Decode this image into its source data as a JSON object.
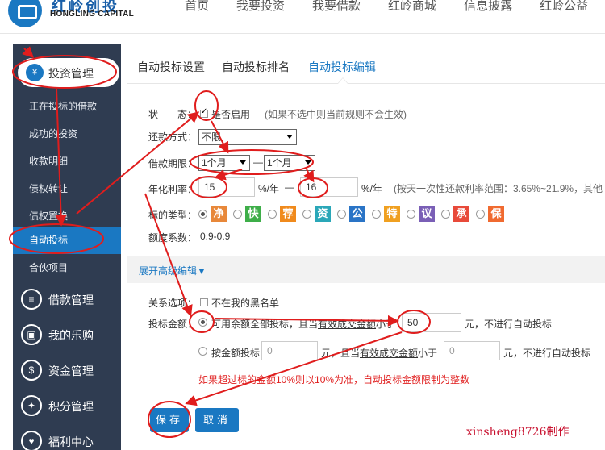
{
  "logo": {
    "cn": "红岭创投",
    "en": "HONGLING CAPITAL"
  },
  "nav": [
    "首页",
    "我要投资",
    "我要借款",
    "红岭商城",
    "信息披露",
    "红岭公益"
  ],
  "sidebar": {
    "header": "投资管理",
    "sub_items": [
      "正在投标的借款",
      "成功的投资",
      "收款明细",
      "债权转让",
      "债权置换",
      "自动投标",
      "合伙项目"
    ],
    "groups": [
      {
        "label": "借款管理",
        "icon": "wallet-icon"
      },
      {
        "label": "我的乐购",
        "icon": "shop-icon"
      },
      {
        "label": "资金管理",
        "icon": "money-bag-icon"
      },
      {
        "label": "积分管理",
        "icon": "gift-icon"
      },
      {
        "label": "福利中心",
        "icon": "heart-icon"
      }
    ]
  },
  "tabs": [
    "自动投标设置",
    "自动投标排名",
    "自动投标编辑"
  ],
  "form": {
    "status_label": "状　　态：",
    "enable_label": "是否启用",
    "enable_hint": "(如果不选中则当前规则不会生效)",
    "repay_label": "还款方式：",
    "repay_value": "不限",
    "term_label": "借款期限：",
    "term_from": "1个月",
    "term_sep": "—",
    "term_to": "1个月",
    "rate_label": "年化利率：",
    "rate_min": "15",
    "rate_unit": "%/年",
    "rate_sep": "—",
    "rate_max": "16",
    "rate_unit2": "%/年",
    "rate_hint": "(按天一次性还款利率范围：3.65%~21.9%，其他",
    "type_label": "标的类型：",
    "types": [
      {
        "char": "净",
        "color": "#e8883a"
      },
      {
        "char": "快",
        "color": "#3eae49"
      },
      {
        "char": "荐",
        "color": "#f08a1c"
      },
      {
        "char": "资",
        "color": "#2aa7b8"
      },
      {
        "char": "公",
        "color": "#2a74c6"
      },
      {
        "char": "特",
        "color": "#f0a020"
      },
      {
        "char": "议",
        "color": "#7a5fb6"
      },
      {
        "char": "承",
        "color": "#e84a3a"
      },
      {
        "char": "保",
        "color": "#f06a30"
      }
    ],
    "coef_label": "额度系数：",
    "coef_value": "0.9-0.9",
    "advanced_link": "展开高级编辑▼",
    "relation_label": "关系选项：",
    "blacklist_label": "不在我的黑名单",
    "amount_label": "投标金额：",
    "opt1_text": "可用余额全部投标，且当",
    "opt1_link": "有效成交金额",
    "opt1_text2": "小于",
    "opt1_value": "50",
    "opt1_tail": "元，不进行自动投标",
    "opt2_text": "按金额投标",
    "opt2_placeholder": "0",
    "opt2_mid": "元，且当",
    "opt2_link": "有效成交金额",
    "opt2_text2": "小于",
    "opt2_placeholder2": "0",
    "opt2_tail": "元，不进行自动投标",
    "warning": "如果超过标的金额10%则以10%为准，自动投标金额限制为整数"
  },
  "buttons": {
    "save": "保存",
    "cancel": "取消"
  },
  "watermark": "xinsheng8726制作",
  "colors": {
    "brand": "#1a78c2",
    "sidebar": "#2f3c51",
    "annotation": "#e01d1d",
    "warning": "#e02020"
  }
}
